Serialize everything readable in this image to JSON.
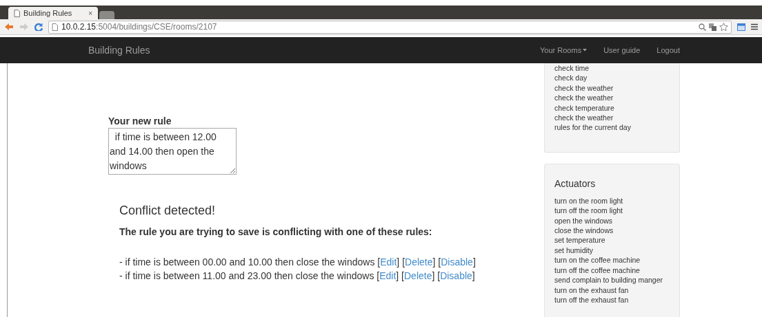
{
  "browser": {
    "tabs": [
      {
        "title": "Building Rules",
        "selected": true
      },
      {
        "selected": false
      }
    ],
    "close_glyph": "×",
    "url_host": "10.0.2.15",
    "url_path": ":5004/buildings/CSE/rooms/2107"
  },
  "navbar": {
    "brand": "Building Rules",
    "items": [
      {
        "label": "Your Rooms",
        "kind": "dropdown"
      },
      {
        "label": "User guide",
        "kind": "link"
      },
      {
        "label": "Logout",
        "kind": "link"
      }
    ]
  },
  "rule_form": {
    "label": "Your new rule",
    "value": "  if time is between 12.00 and 14.00 then open the windows"
  },
  "conflict": {
    "title": "Conflict detected!",
    "message": "The rule you are trying to save is conflicting with one of these rules:",
    "brackets": [
      "[",
      "]"
    ],
    "rules": [
      {
        "text": "- if time is between 00.00 and 10.00 then close the windows",
        "actions": [
          "Edit",
          "Delete",
          "Disable"
        ]
      },
      {
        "text": "- if time is between 11.00 and 23.00 then close the windows",
        "actions": [
          "Edit",
          "Delete",
          "Disable"
        ]
      }
    ]
  },
  "sidebar": [
    {
      "items": [
        "check time",
        "check day",
        "check the weather",
        "check the weather",
        "check temperature",
        "check the weather",
        "rules for the current day"
      ]
    },
    {
      "title": "Actuators",
      "items": [
        "turn on the room light",
        "turn off the room light",
        "open the windows",
        "close the windows",
        "set temperature",
        "set humidity",
        "turn on the coffee machine",
        "turn off the coffee machine",
        "send complain to building manger",
        "turn on the exhaust fan",
        "turn off the exhaust fan"
      ]
    }
  ]
}
